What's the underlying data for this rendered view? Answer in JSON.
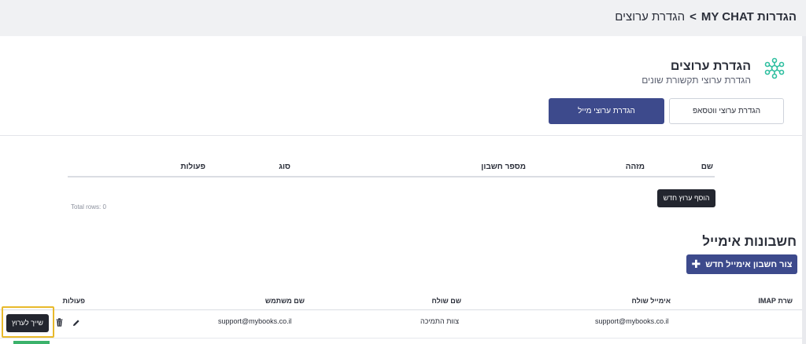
{
  "breadcrumb": {
    "root": "הגדרות MY CHAT",
    "separator": ">",
    "current": "הגדרת ערוצים"
  },
  "header": {
    "title": "הגדרת ערוצים",
    "subtitle": "הגדרת ערוצי תקשורת שונים"
  },
  "channel_tabs": {
    "whatsapp": "הגדרת ערוצי ווטסאפ",
    "email": "הגדרת ערוצי מייל"
  },
  "channels_table": {
    "columns": {
      "name": "שם",
      "id": "מזהה",
      "account": "מספר חשבון",
      "type": "סוג",
      "actions": "פעולות"
    },
    "add_button": "הוסף ערוץ חדש",
    "total_rows": "Total rows: 0"
  },
  "email_section": {
    "title": "חשבונות אימייל",
    "new_button": "צור חשבון אימייל חדש",
    "columns": {
      "imap": "שרת IMAP",
      "sender_email": "אימייל שולח",
      "sender_name": "שם שולח",
      "username": "שם משתמש",
      "actions": "פעולות"
    },
    "rows": [
      {
        "imap": "",
        "sender_email": "support@mybooks.co.il",
        "sender_name": "צוות התמיכה",
        "username": "support@mybooks.co.il",
        "assign_label": "שייך לערוץ"
      }
    ]
  },
  "colors": {
    "primary": "#3d4a8c",
    "dark_button": "#23262f",
    "highlight": "#e8b92b",
    "icon_teal": "#2fbfa0"
  }
}
